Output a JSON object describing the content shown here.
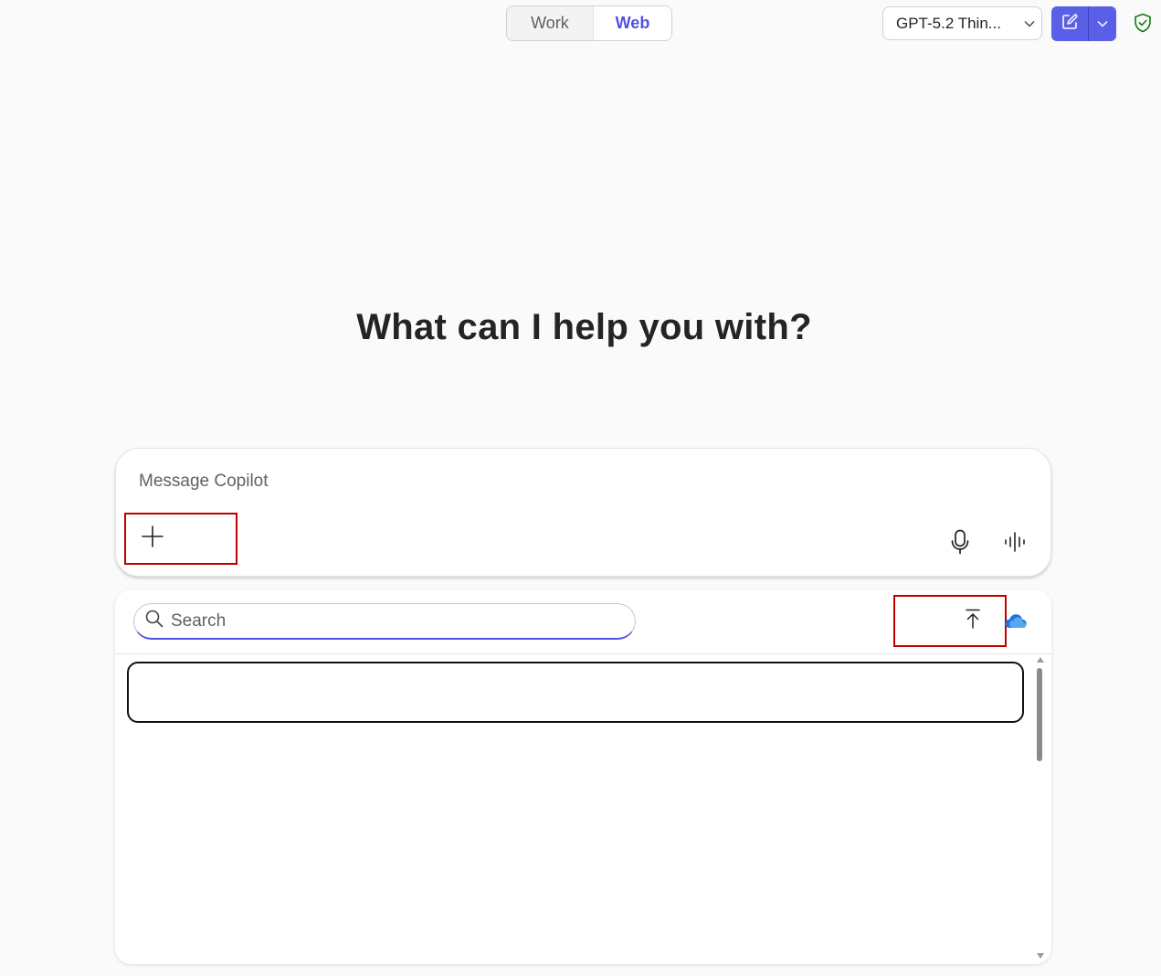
{
  "mode_toggle": {
    "work_label": "Work",
    "web_label": "Web",
    "selected": "Web"
  },
  "model_selector": {
    "label": "GPT-5.2 Thin..."
  },
  "header_icons": {
    "new_chat": "compose-icon",
    "new_chat_menu": "chevron-down-icon",
    "privacy": "shield-check-icon"
  },
  "main": {
    "heading": "What can I help you with?"
  },
  "composer": {
    "placeholder": "Message Copilot",
    "icons": {
      "add": "plus-icon",
      "mic": "microphone-icon",
      "voice": "voice-waveform-icon"
    }
  },
  "attach_panel": {
    "search_placeholder": "Search",
    "icons": {
      "search": "search-icon",
      "upload": "upload-icon",
      "onedrive": "onedrive-cloud-icon"
    }
  },
  "colors": {
    "accent": "#4f52e0",
    "new_chat_bg": "#5b5fe8",
    "highlight_box": "#c00000",
    "shield": "#107c10"
  }
}
